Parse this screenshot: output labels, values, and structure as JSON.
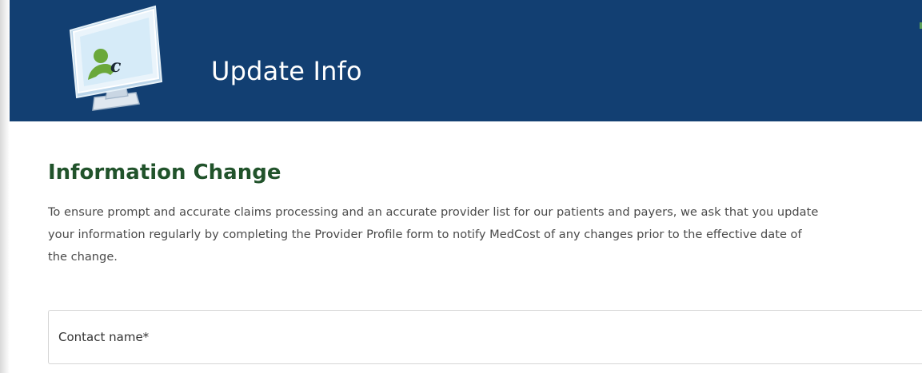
{
  "header": {
    "title": "Update Info"
  },
  "main": {
    "section_title": "Information Change",
    "intro_lines": [
      "To ensure prompt and accurate claims processing and an accurate provider list for our patients and payers, we ask that you update",
      "your information regularly by completing the Provider Profile form to notify MedCost of any changes prior to the effective date of",
      "the change."
    ]
  },
  "form": {
    "contact_name_label": "Contact name*"
  },
  "icons": {
    "logo": "monitor-user-icon"
  },
  "colors": {
    "header_bg": "#123f72",
    "title_green": "#21532b",
    "logo_green": "#6aa83a"
  }
}
